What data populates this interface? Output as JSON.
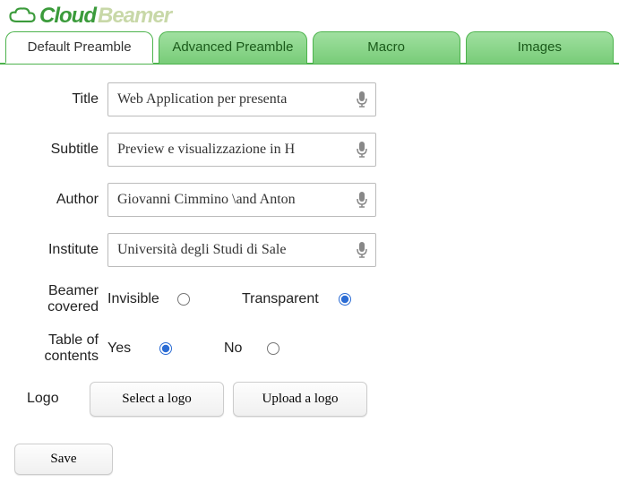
{
  "brand": {
    "part1": "Cloud",
    "part2": "Beamer"
  },
  "tabs": [
    {
      "label": "Default Preamble",
      "active": true
    },
    {
      "label": "Advanced Preamble",
      "active": false
    },
    {
      "label": "Macro",
      "active": false
    },
    {
      "label": "Images",
      "active": false
    }
  ],
  "fields": {
    "title": {
      "label": "Title",
      "value": "Web Application per presenta"
    },
    "subtitle": {
      "label": "Subtitle",
      "value": "Preview e visualizzazione in H"
    },
    "author": {
      "label": "Author",
      "value": "Giovanni Cimmino \\and Anton"
    },
    "institute": {
      "label": "Institute",
      "value": "Università degli Studi di Sale"
    }
  },
  "beamer": {
    "label": "Beamer covered",
    "opt1": "Invisible",
    "opt2": "Transparent",
    "selected": "Transparent"
  },
  "toc": {
    "label": "Table of contents",
    "opt1": "Yes",
    "opt2": "No",
    "selected": "Yes"
  },
  "logoRow": {
    "label": "Logo",
    "selectBtn": "Select a logo",
    "uploadBtn": "Upload a logo"
  },
  "saveBtn": "Save"
}
